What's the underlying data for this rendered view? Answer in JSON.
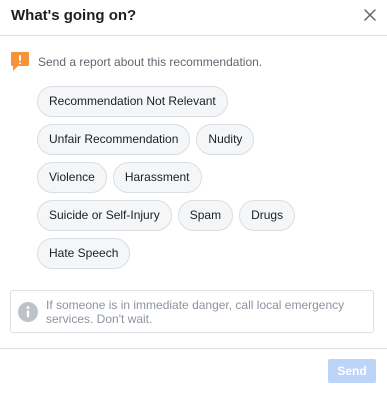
{
  "dialog": {
    "title": "What's going on?",
    "notice_text": "Send a report about this recommendation.",
    "danger_text": "If someone is in immediate danger, call local emergency services. Don't wait.",
    "send_label": "Send"
  },
  "tags": {
    "rows": [
      [
        "Recommendation Not Relevant"
      ],
      [
        "Unfair Recommendation",
        "Nudity"
      ],
      [
        "Violence",
        "Harassment"
      ],
      [
        "Suicide or Self-Injury",
        "Spam",
        "Drugs"
      ],
      [
        "Hate Speech"
      ]
    ]
  },
  "icons": {
    "close": "close-icon",
    "notice": "flag-exclamation-icon",
    "info": "info-icon"
  },
  "colors": {
    "notice_icon": "#f7923b",
    "info_icon": "#bec3c9",
    "send_bg": "#bcd4f7",
    "tag_bg": "#f5f6f7",
    "tag_border": "#dadde1"
  }
}
